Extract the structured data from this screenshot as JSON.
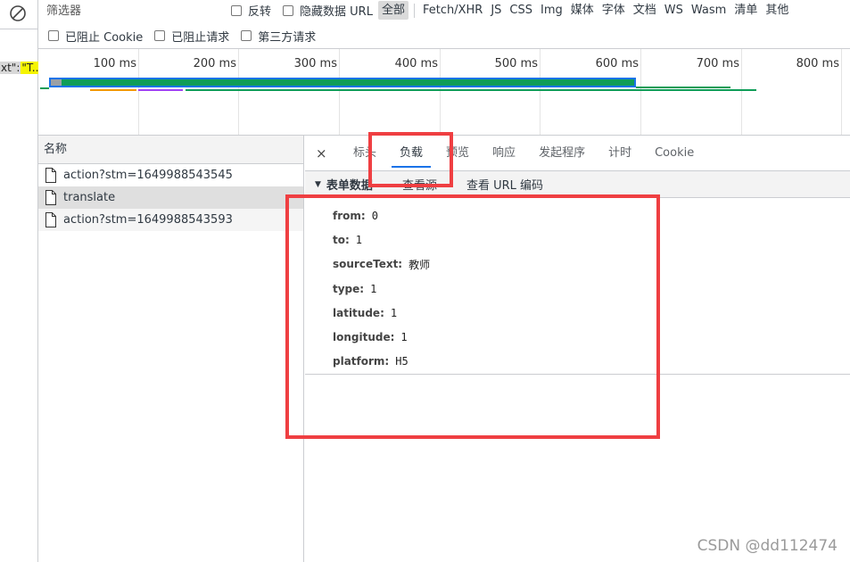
{
  "toolbar": {
    "filter_placeholder": "筛选器",
    "invert_label": "反转",
    "hide_data_urls_label": "隐藏数据 URL",
    "type_filters": [
      "全部",
      "Fetch/XHR",
      "JS",
      "CSS",
      "Img",
      "媒体",
      "字体",
      "文档",
      "WS",
      "Wasm",
      "清单",
      "其他"
    ],
    "active_type": "全部",
    "blocked_cookies_label": "已阻止 Cookie",
    "blocked_requests_label": "已阻止请求",
    "third_party_label": "第三方请求"
  },
  "gutter": {
    "snippet_a": "xt\":",
    "snippet_b": "\"T..."
  },
  "timeline": {
    "ticks": [
      "100 ms",
      "200 ms",
      "300 ms",
      "400 ms",
      "500 ms",
      "600 ms",
      "700 ms",
      "800 ms"
    ],
    "colors": {
      "green": "#0f9d58",
      "blue": "#1a73e8",
      "orange": "#f29900",
      "purple": "#a142f4"
    }
  },
  "requests": {
    "header": "名称",
    "items": [
      {
        "name": "action?stm=1649988543545"
      },
      {
        "name": "translate"
      },
      {
        "name": "action?stm=1649988543593"
      }
    ],
    "selected": "translate"
  },
  "details": {
    "close_label": "×",
    "tabs": [
      "标头",
      "负载",
      "预览",
      "响应",
      "发起程序",
      "计时",
      "Cookie"
    ],
    "active_tab": "负载",
    "section_title": "表单数据",
    "view_source_label": "查看源",
    "view_url_encoded_label": "查看 URL 编码",
    "params": [
      {
        "key": "from:",
        "value": "0"
      },
      {
        "key": "to:",
        "value": "1"
      },
      {
        "key": "sourceText:",
        "value": "教师"
      },
      {
        "key": "type:",
        "value": "1"
      },
      {
        "key": "latitude:",
        "value": "1"
      },
      {
        "key": "longitude:",
        "value": "1"
      },
      {
        "key": "platform:",
        "value": "H5"
      }
    ]
  },
  "watermark": "CSDN @dd112474",
  "highlight_color": "#ef3f42"
}
